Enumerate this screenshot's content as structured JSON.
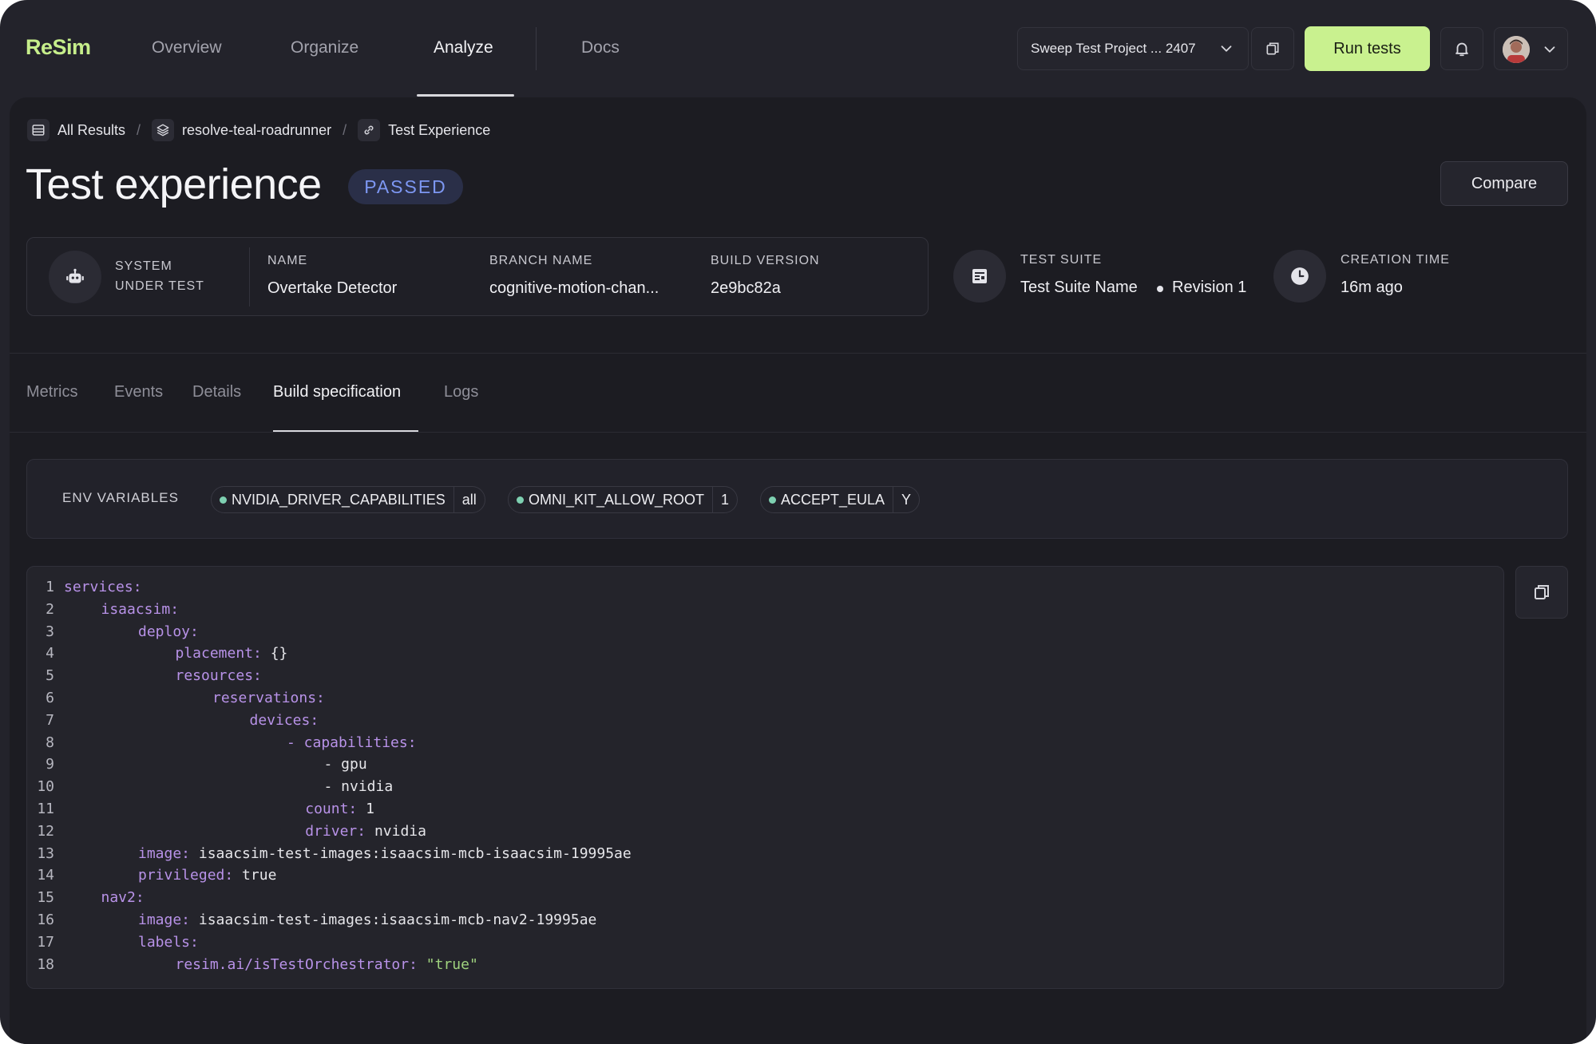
{
  "header": {
    "logo": "ReSim",
    "nav": [
      "Overview",
      "Organize",
      "Analyze",
      "Docs"
    ],
    "active_nav": "Analyze",
    "project": "Sweep Test Project ... 2407",
    "run_button": "Run tests"
  },
  "breadcrumb": [
    "All Results",
    "resolve-teal-roadrunner",
    "Test Experience"
  ],
  "page": {
    "title": "Test experience",
    "status": "PASSED",
    "compare_button": "Compare"
  },
  "meta": {
    "system_under_test_label_1": "SYSTEM",
    "system_under_test_label_2": "UNDER TEST",
    "name_label": "NAME",
    "name_value": "Overtake Detector",
    "branch_label": "BRANCH NAME",
    "branch_value": "cognitive-motion-chan...",
    "build_label": "BUILD VERSION",
    "build_value": "2e9bc82a",
    "suite_label": "TEST SUITE",
    "suite_name": "Test Suite Name",
    "suite_revision": "Revision 1",
    "creation_label": "CREATION TIME",
    "creation_value": "16m ago"
  },
  "tabs": [
    "Metrics",
    "Events",
    "Details",
    "Build specification",
    "Logs"
  ],
  "active_tab": "Build specification",
  "env": {
    "label": "ENV VARIABLES",
    "vars": [
      {
        "key": "NVIDIA_DRIVER_CAPABILITIES",
        "value": "all"
      },
      {
        "key": "OMNI_KIT_ALLOW_ROOT",
        "value": "1"
      },
      {
        "key": "ACCEPT_EULA",
        "value": "Y"
      }
    ]
  },
  "code": {
    "lines": [
      {
        "n": "1",
        "indent": 0,
        "key": "services:",
        "value": ""
      },
      {
        "n": "2",
        "indent": 1,
        "key": "isaacsim:",
        "value": ""
      },
      {
        "n": "3",
        "indent": 2,
        "key": "deploy:",
        "value": ""
      },
      {
        "n": "4",
        "indent": 3,
        "key": "placement:",
        "value": " {}"
      },
      {
        "n": "5",
        "indent": 3,
        "key": "resources:",
        "value": ""
      },
      {
        "n": "6",
        "indent": 4,
        "key": "reservations:",
        "value": ""
      },
      {
        "n": "7",
        "indent": 5,
        "key": "devices:",
        "value": ""
      },
      {
        "n": "8",
        "indent": 6,
        "key": "- capabilities:",
        "value": ""
      },
      {
        "n": "9",
        "indent": 7,
        "key": "",
        "value": "- gpu"
      },
      {
        "n": "10",
        "indent": 7,
        "key": "",
        "value": "- nvidia"
      },
      {
        "n": "11",
        "indent": 6.5,
        "key": "count:",
        "value": " 1"
      },
      {
        "n": "12",
        "indent": 6.5,
        "key": "driver:",
        "value": " nvidia"
      },
      {
        "n": "13",
        "indent": 2,
        "key": "image:",
        "value": " isaacsim-test-images:isaacsim-mcb-isaacsim-19995ae"
      },
      {
        "n": "14",
        "indent": 2,
        "key": "privileged:",
        "value": " true"
      },
      {
        "n": "15",
        "indent": 1,
        "key": "nav2:",
        "value": ""
      },
      {
        "n": "16",
        "indent": 2,
        "key": "image:",
        "value": " isaacsim-test-images:isaacsim-mcb-nav2-19995ae"
      },
      {
        "n": "17",
        "indent": 2,
        "key": "labels:",
        "value": ""
      },
      {
        "n": "18",
        "indent": 3,
        "key": "resim.ai/isTestOrchestrator:",
        "value": "",
        "string": " \"true\""
      }
    ]
  },
  "colors": {
    "accent": "#c9f18f",
    "status_passed": "#7d97f2",
    "env_dot": "#7ed0b1",
    "code_key": "#b892e8",
    "code_string": "#9fd27e"
  },
  "icons": {
    "project_chevron": "chevron-down-icon",
    "copy": "copy-icon",
    "bell": "bell-icon",
    "robot": "robot-icon",
    "suite": "list-icon",
    "clock": "clock-icon"
  }
}
